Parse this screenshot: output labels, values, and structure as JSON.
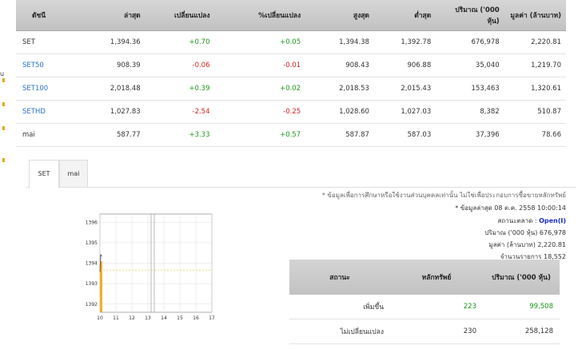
{
  "header": {
    "col_index": "ดัชนี",
    "col_last": "ล่าสุด",
    "col_change": "เปลี่ยนแปลง",
    "col_pct_change": "%เปลี่ยนแปลง",
    "col_high": "สูงสุด",
    "col_low": "ต่ำสุด",
    "col_volume": "ปริมาณ ('000 หุ้น)",
    "col_value": "มูลค่า (ล้านบาท)"
  },
  "rows": [
    {
      "name": "SET",
      "last": "1,394.36",
      "change": "+0.70",
      "pct": "+0.05",
      "high": "1,394.38",
      "low": "1,392.78",
      "volume": "676,978",
      "value": "2,220.81"
    },
    {
      "name": "SET50",
      "last": "908.39",
      "change": "-0.06",
      "pct": "-0.01",
      "high": "908.43",
      "low": "906.88",
      "volume": "35,040",
      "value": "1,219.70"
    },
    {
      "name": "SET100",
      "last": "2,018.48",
      "change": "+0.39",
      "pct": "+0.02",
      "high": "2,018.53",
      "low": "2,015.43",
      "volume": "153,463",
      "value": "1,320.61"
    },
    {
      "name": "SETHD",
      "last": "1,027.83",
      "change": "-2.54",
      "pct": "-0.25",
      "high": "1,028.60",
      "low": "1,027.03",
      "volume": "8,382",
      "value": "510.87"
    },
    {
      "name": "mai",
      "last": "587.77",
      "change": "+3.33",
      "pct": "+0.57",
      "high": "587.87",
      "low": "587.03",
      "volume": "37,396",
      "value": "78.66"
    }
  ],
  "tabs": [
    {
      "label": "SET"
    },
    {
      "label": "mai"
    }
  ],
  "info": {
    "note": "* ข้อมูลเพื่อการศึกษาหรือใช้งานส่วนบุคคลเท่านั้น ไม่ใช่เพื่อประกอบการซื้อขายหลักทรัพย์",
    "updated": "* ข้อมูลล่าสุด 08 ต.ค. 2558 10:00:14",
    "market_label": "สถานะตลาด :",
    "market_status": "Open(I)",
    "volume": "ปริมาณ ('000 หุ้น) 676,978",
    "value": "มูลค่า (ล้านบาท) 2,220.81",
    "trades": "จำนวนรายการ 18,552"
  },
  "sub_table": {
    "headers": {
      "status": "สถานะ",
      "securities": "หลักทรัพย์",
      "volume": "ปริมาณ ('000 หุ้น)"
    },
    "rows": [
      {
        "status": "เพิ่มขึ้น",
        "securities": "223",
        "volume": "99,508"
      },
      {
        "status": "ไม่เปลี่ยนแปลง",
        "securities": "230",
        "volume": "258,128"
      }
    ]
  },
  "chart_data": {
    "type": "line",
    "x_ticks": [
      "10",
      "11",
      "12",
      "13",
      "14",
      "15",
      "16",
      "17"
    ],
    "y_ticks": [
      "1392",
      "1393",
      "1394",
      "1395",
      "1396"
    ],
    "ylim": [
      1391.6,
      1396.4
    ],
    "xlim": [
      10,
      17
    ],
    "series": [
      {
        "values_x": [
          10,
          10.05,
          10.1
        ],
        "values_y": [
          1393.6,
          1394.4,
          1394.36
        ]
      }
    ],
    "reference": 1393.66,
    "bar_volume_end_x": 10.1,
    "colors": {
      "line": "#555555",
      "bar": "#f0b020",
      "reference": "#e8d060"
    }
  },
  "left_menu": {
    "fragment": "u"
  }
}
